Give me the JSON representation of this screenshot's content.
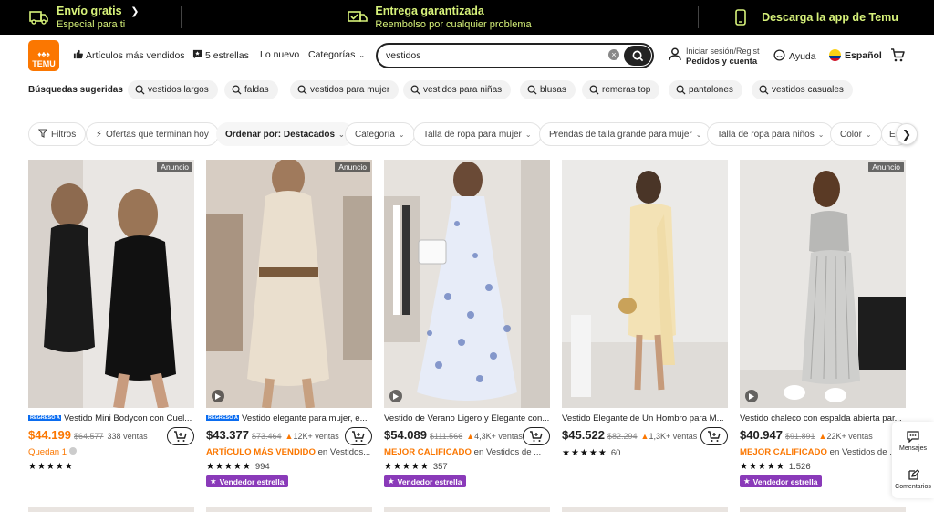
{
  "promo": {
    "shipping_title": "Envío gratis",
    "shipping_sub": "Especial para ti",
    "delivery_title": "Entrega garantizada",
    "delivery_sub": "Reembolso por cualquier problema",
    "app_text": "Descarga la app de Temu"
  },
  "header": {
    "logo_text": "TEMU",
    "best_sellers": "Artículos más vendidos",
    "five_stars": "5 estrellas",
    "new": "Lo nuevo",
    "categories": "Categorías",
    "search_value": "vestidos",
    "login_line1": "Iniciar sesión/Regist",
    "login_line2": "Pedidos y cuenta",
    "help": "Ayuda",
    "language": "Español"
  },
  "suggested": {
    "label": "Búsquedas sugeridas",
    "items": [
      "vestidos largos",
      "faldas",
      "vestidos para mujer",
      "vestidos para niñas",
      "blusas",
      "remeras top",
      "pantalones",
      "vestidos casuales"
    ]
  },
  "filters": {
    "items": [
      "Filtros",
      "Ofertas que terminan hoy",
      "Ordenar por: Destacados",
      "Categoría",
      "Talla de ropa para mujer",
      "Prendas de talla grande para mujer",
      "Talla de ropa para niños",
      "Color",
      "Es"
    ]
  },
  "products": [
    {
      "ad": "Anuncio",
      "tag": "REGRESO A CLASES",
      "title": "Vestido Mini Bodycon con Cuel...",
      "price_int": "$44.199",
      "old": "$64.577",
      "sold": "338 ventas",
      "badge_hl": "Quedan 1",
      "badge_rest": "",
      "stars": "★★★★★",
      "rating": "",
      "star_seller": ""
    },
    {
      "ad": "Anuncio",
      "tag": "REGRESO A CLASES",
      "title": "Vestido elegante para mujer, e...",
      "price_int": "$43.377",
      "old": "$73.464",
      "sold": "12K+ ventas",
      "badge_hl": "ARTÍCULO MÁS VENDIDO",
      "badge_rest": " en Vestidos...",
      "stars": "★★★★★",
      "rating": "994",
      "star_seller": "Vendedor estrella"
    },
    {
      "ad": "",
      "tag": "",
      "title": "Vestido de Verano Ligero y Elegante con...",
      "price_int": "$54.089",
      "old": "$111.566",
      "sold": "4,3K+ ventas",
      "badge_hl": "MEJOR CALIFICADO",
      "badge_rest": " en Vestidos de ...",
      "stars": "★★★★★",
      "rating": "357",
      "star_seller": "Vendedor estrella"
    },
    {
      "ad": "",
      "tag": "",
      "title": "Vestido Elegante de Un Hombro para M...",
      "price_int": "$45.522",
      "old": "$82.294",
      "sold": "1,3K+ ventas",
      "badge_hl": "",
      "badge_rest": "",
      "stars": "★★★★★",
      "rating": "60",
      "star_seller": ""
    },
    {
      "ad": "Anuncio",
      "tag": "",
      "title": "Vestido chaleco con espalda abierta par...",
      "price_int": "$40.947",
      "old": "$91.891",
      "sold": "22K+ ventas",
      "badge_hl": "MEJOR CALIFICADO",
      "badge_rest": " en Vestidos de ...",
      "stars": "★★★★★",
      "rating": "1.526",
      "star_seller": "Vendedor estrella"
    }
  ],
  "side": {
    "messages": "Mensajes",
    "comments": "Comentarios"
  },
  "colors": {
    "accent": "#fb7701",
    "promo_text": "#d7f27a",
    "star_badge": "#8a3ab9",
    "tag_blue": "#0a6cf0"
  }
}
